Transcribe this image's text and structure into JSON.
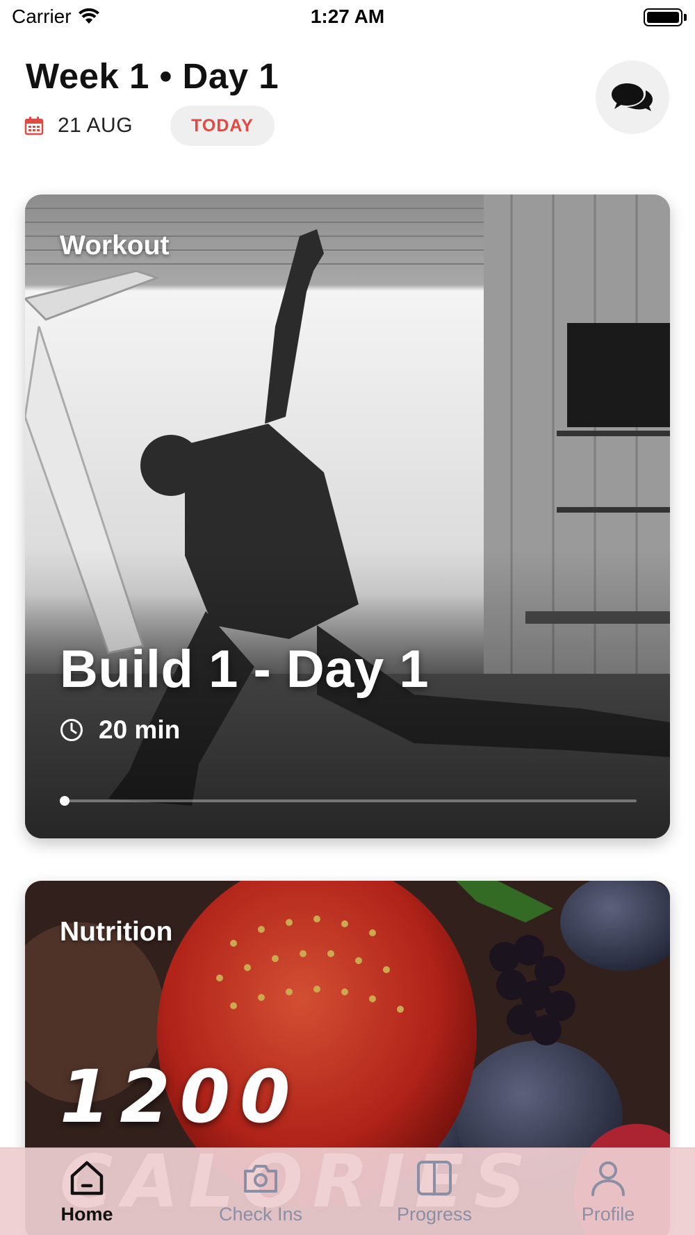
{
  "status_bar": {
    "carrier": "Carrier",
    "time": "1:27 AM"
  },
  "header": {
    "title": "Week 1 • Day 1",
    "date": "21 AUG",
    "today_badge": "TODAY",
    "chat_icon": "chat-bubbles-icon"
  },
  "workout_card": {
    "label": "Workout",
    "title": "Build 1 - Day 1",
    "duration": "20 min",
    "progress": 0.01
  },
  "nutrition_card": {
    "label": "Nutrition",
    "headline": "1200 CALORIES"
  },
  "tab_bar": {
    "items": [
      {
        "label": "Home",
        "icon": "home-icon",
        "active": true
      },
      {
        "label": "Check Ins",
        "icon": "camera-icon",
        "active": false
      },
      {
        "label": "Progress",
        "icon": "split-panel-icon",
        "active": false
      },
      {
        "label": "Profile",
        "icon": "person-icon",
        "active": false
      }
    ]
  },
  "colors": {
    "accent": "#e14a40",
    "tab_bar_bg": "#eecdd1",
    "tab_inactive": "#8a8fa6"
  }
}
